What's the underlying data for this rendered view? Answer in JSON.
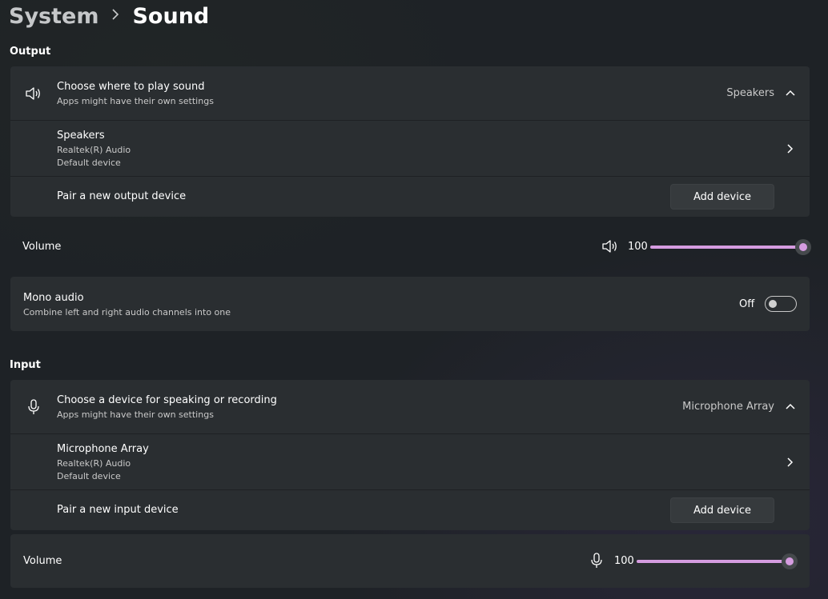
{
  "breadcrumb": {
    "parent": "System",
    "current": "Sound"
  },
  "output": {
    "section_title": "Output",
    "choose": {
      "title": "Choose where to play sound",
      "subtitle": "Apps might have their own settings",
      "value": "Speakers",
      "icon": "speaker-icon"
    },
    "device": {
      "name": "Speakers",
      "line1": "Realtek(R) Audio",
      "line2": "Default device"
    },
    "pair": {
      "label": "Pair a new output device",
      "button": "Add device"
    },
    "volume": {
      "label": "Volume",
      "value": "100",
      "level": 1.0,
      "icon": "speaker-icon"
    },
    "mono": {
      "title": "Mono audio",
      "subtitle": "Combine left and right audio channels into one",
      "state": "Off"
    }
  },
  "input": {
    "section_title": "Input",
    "choose": {
      "title": "Choose a device for speaking or recording",
      "subtitle": "Apps might have their own settings",
      "value": "Microphone Array",
      "icon": "microphone-icon"
    },
    "device": {
      "name": "Microphone Array",
      "line1": "Realtek(R) Audio",
      "line2": "Default device"
    },
    "pair": {
      "label": "Pair a new input device",
      "button": "Add device"
    },
    "volume": {
      "label": "Volume",
      "value": "100",
      "level": 1.0,
      "icon": "microphone-icon"
    }
  },
  "colors": {
    "accent": "#d59ce0",
    "card": "#2a2e31",
    "background": "#1e2226"
  }
}
